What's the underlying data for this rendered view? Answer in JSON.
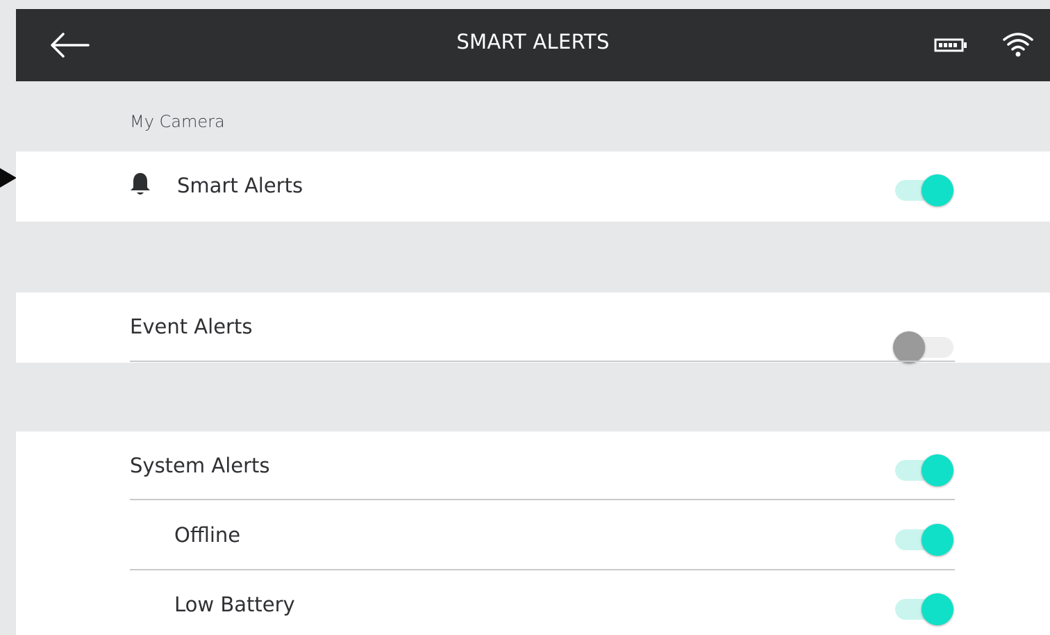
{
  "header": {
    "title": "SMART ALERTS",
    "back_icon": "back-arrow-icon",
    "battery_icon": "battery-icon",
    "wifi_icon": "wifi-icon"
  },
  "section": {
    "label": "My Camera"
  },
  "smart_alerts": {
    "label": "Smart Alerts",
    "icon": "bell-icon",
    "enabled": true
  },
  "event_alerts": {
    "label": "Event Alerts",
    "enabled": false
  },
  "system_alerts": {
    "label": "System Alerts",
    "enabled": true
  },
  "offline": {
    "label": "Offline",
    "enabled": true
  },
  "low_battery": {
    "label": "Low Battery",
    "enabled": true
  },
  "colors": {
    "header_bg": "#2e2f31",
    "page_bg": "#e6e8ea",
    "toggle_on": "#11e0c8",
    "toggle_on_track": "#c9f5ee",
    "toggle_off": "#9a9a9a"
  }
}
